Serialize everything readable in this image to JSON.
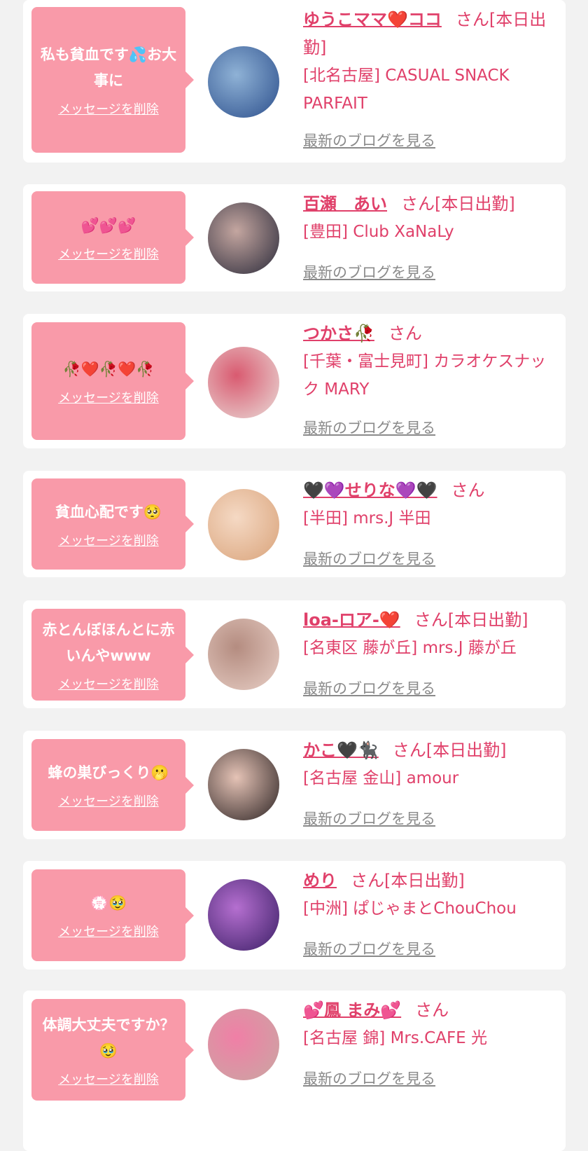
{
  "cards": [
    {
      "message": "私も貧血です💦お大事に",
      "delete_label": "メッセージを削除",
      "name": "ゆうこママ❤️ココ",
      "suffix": "さん[本日出勤]",
      "shop": "[北名古屋] CASUAL SNACK PARFAIT",
      "blog_label": "最新のブログを見る",
      "avatar_colors": [
        "#2c4f8c",
        "#8fb2d6"
      ]
    },
    {
      "message": "💕💕💕",
      "delete_label": "メッセージを削除",
      "name": "百瀬　あい",
      "suffix": "さん[本日出勤]",
      "shop": "[豊田] Club XaNaLy",
      "blog_label": "最新のブログを見る",
      "avatar_colors": [
        "#2a2a3a",
        "#c4a6a0"
      ]
    },
    {
      "message": "🥀❤️🥀❤️🥀",
      "delete_label": "メッセージを削除",
      "name": "つかさ🥀",
      "suffix": "さん",
      "shop": "[千葉・富士見町] カラオケスナック MARY",
      "blog_label": "最新のブログを見る",
      "avatar_colors": [
        "#e9dcd8",
        "#d95a70"
      ]
    },
    {
      "message": "貧血心配です🥺",
      "delete_label": "メッセージを削除",
      "name": "🖤💜せりな💜🖤",
      "suffix": "さん",
      "shop": "[半田] mrs.J 半田",
      "blog_label": "最新のブログを見る",
      "avatar_colors": [
        "#d9a37a",
        "#f5d9c4"
      ]
    },
    {
      "message": "赤とんぼほんとに赤いんやwww",
      "delete_label": "メッセージを削除",
      "name": "loa-ロア-❤️",
      "suffix": "さん[本日出勤]",
      "shop": "[名東区 藤が丘] mrs.J 藤が丘",
      "blog_label": "最新のブログを見る",
      "avatar_colors": [
        "#e8cfc6",
        "#b48c80"
      ]
    },
    {
      "message": "蜂の巣びっくり🫢",
      "delete_label": "メッセージを削除",
      "name": "かこ🖤🐈‍⬛",
      "suffix": "さん[本日出勤]",
      "shop": "[名古屋 金山] amour",
      "blog_label": "最新のブログを見る",
      "avatar_colors": [
        "#2b2222",
        "#e5c3b6"
      ]
    },
    {
      "message": "💮🥹",
      "delete_label": "メッセージを削除",
      "name": "めり",
      "suffix": "さん[本日出勤]",
      "shop": "[中洲] ぱじゃまとChouChou",
      "blog_label": "最新のブログを見る",
      "avatar_colors": [
        "#3b1f66",
        "#b56fd0"
      ]
    },
    {
      "message": "体調大丈夫ですか？🥹",
      "delete_label": "メッセージを削除",
      "name": "💕鳳 まみ💕",
      "suffix": "さん",
      "shop": "[名古屋 錦] Mrs.CAFE 光",
      "blog_label": "最新のブログを見る",
      "avatar_colors": [
        "#c9a7a2",
        "#f07fa6"
      ]
    }
  ]
}
